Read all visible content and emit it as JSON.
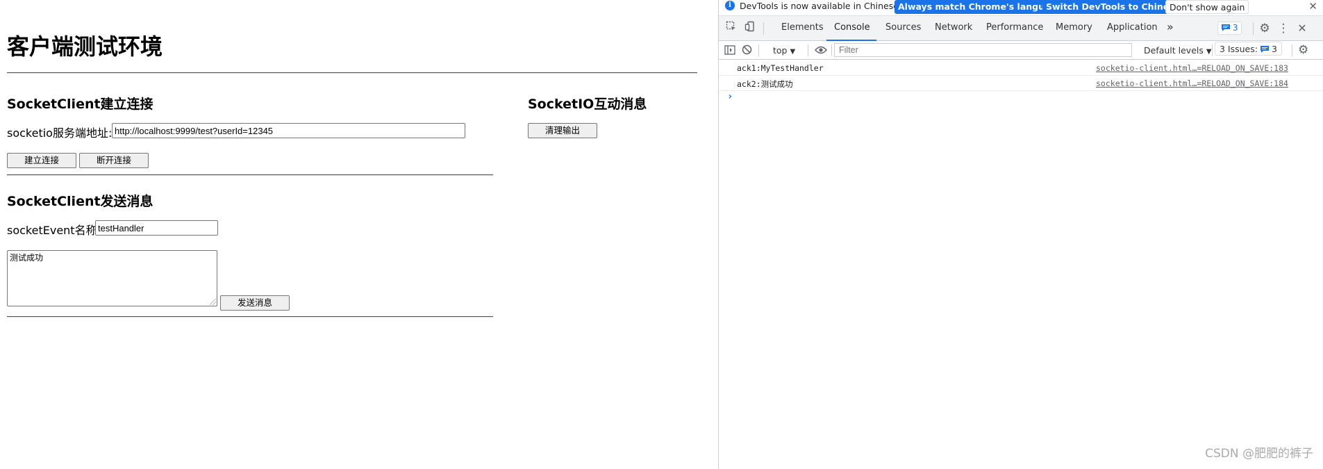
{
  "page": {
    "title": "客户端测试环境",
    "connect": {
      "heading": "SocketClient建立连接",
      "url_label": "socketio服务端地址:",
      "url_value": "http://localhost:9999/test?userId=12345",
      "connect_button": "建立连接",
      "disconnect_button": "断开连接"
    },
    "send": {
      "heading": "SocketClient发送消息",
      "event_label": "socketEvent名称:",
      "event_value": "testHandler",
      "message_value": "测试成功",
      "send_button": "发送消息"
    },
    "interaction": {
      "heading": "SocketIO互动消息",
      "clear_button": "清理输出"
    }
  },
  "devtools": {
    "infobar": {
      "text": "DevTools is now available in Chinese!",
      "match_button": "Always match Chrome's language",
      "switch_button": "Switch DevTools to Chinese",
      "dismiss_button": "Don't show again"
    },
    "tabs": [
      "Elements",
      "Console",
      "Sources",
      "Network",
      "Performance",
      "Memory",
      "Application"
    ],
    "active_tab": "Console",
    "issues_badge": "3",
    "toolbar": {
      "context": "top",
      "filter_placeholder": "Filter",
      "levels": "Default levels",
      "issues_label": "3 Issues:",
      "issues_count": "3"
    },
    "messages": [
      {
        "text": "ack1:MyTestHandler",
        "source": "socketio-client.html…=RELOAD_ON_SAVE:183"
      },
      {
        "text": "ack2:测试成功",
        "source": "socketio-client.html…=RELOAD_ON_SAVE:184"
      }
    ],
    "prompt": "›",
    "accent": "#1a73e8"
  },
  "watermark": "CSDN @肥肥的裤子"
}
